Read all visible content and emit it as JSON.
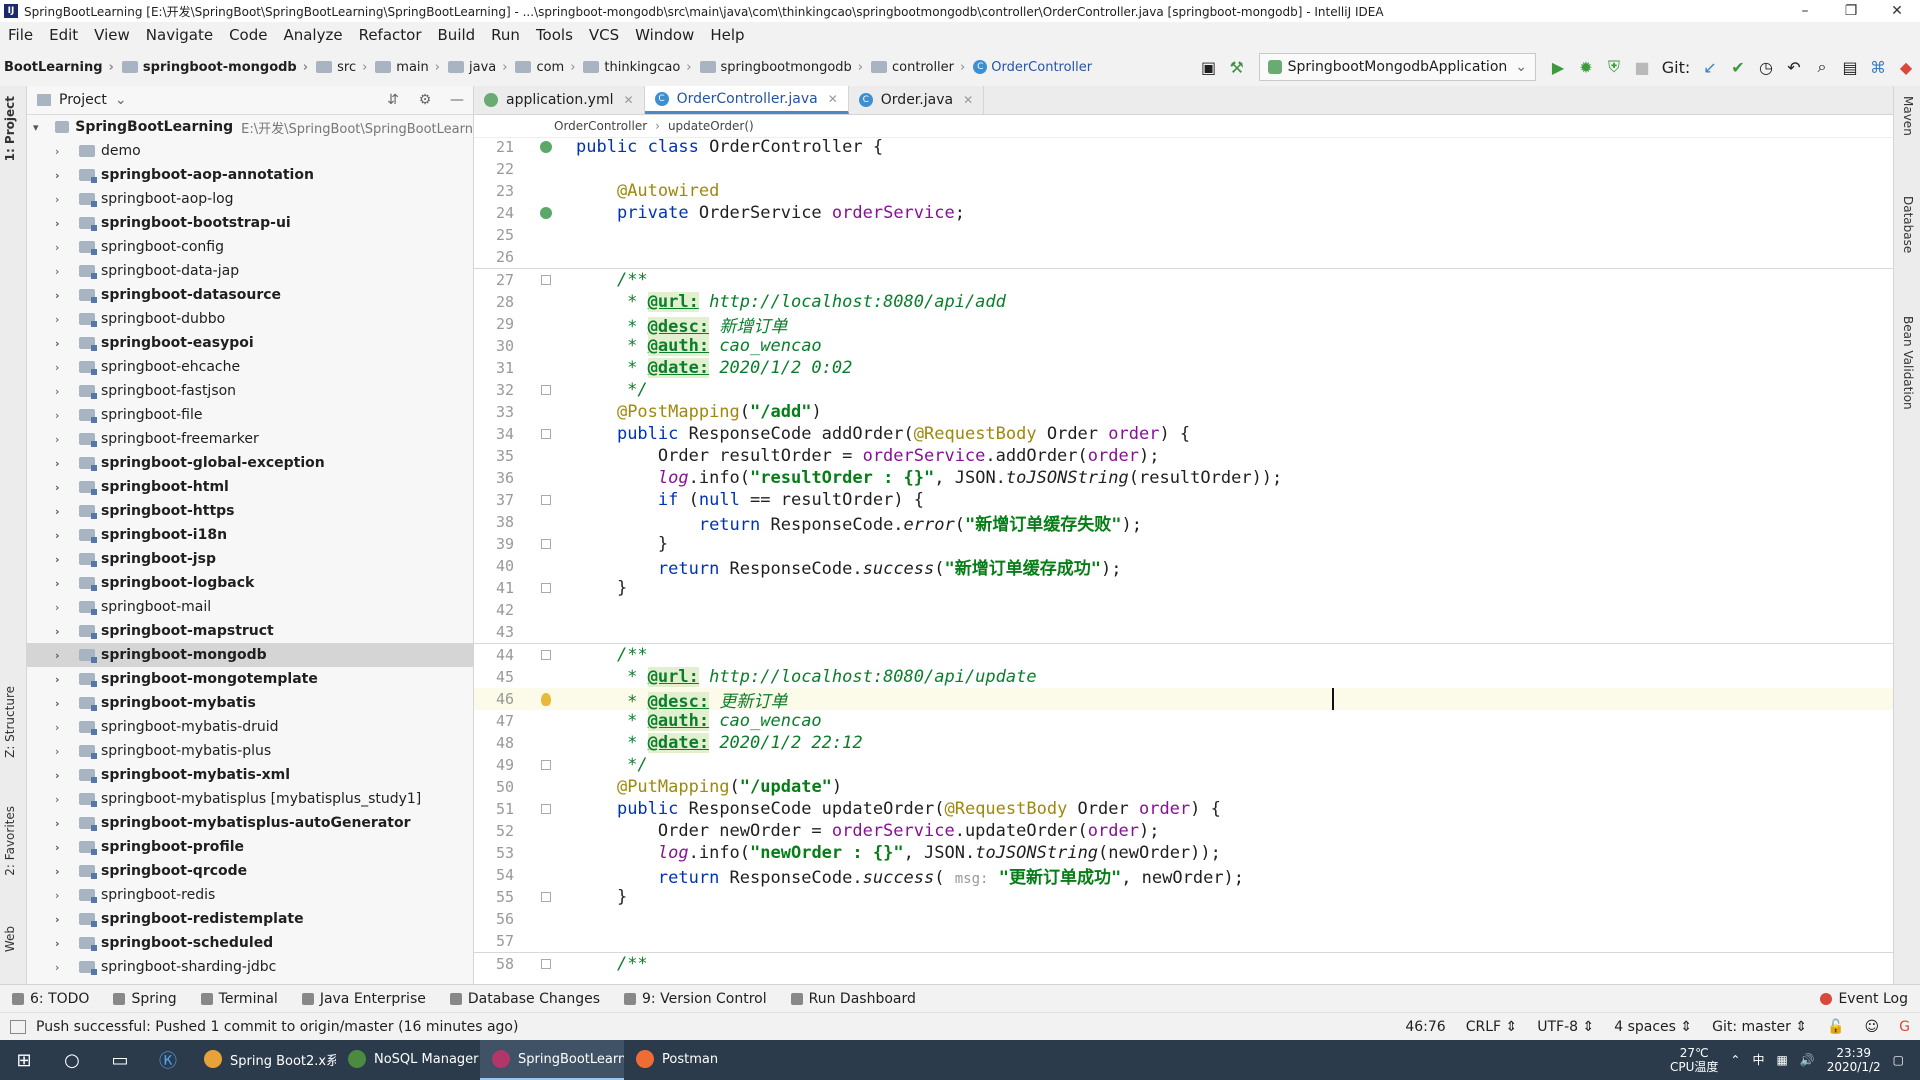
{
  "window": {
    "title": "SpringBootLearning [E:\\开发\\SpringBoot\\SpringBootLearning\\SpringBootLearning] - ...\\springboot-mongodb\\src\\main\\java\\com\\thinkingcao\\springbootmongodb\\controller\\OrderController.java [springboot-mongodb] - IntelliJ IDEA",
    "minimize": "–",
    "restore": "❐",
    "close": "✕"
  },
  "menu": [
    "File",
    "Edit",
    "View",
    "Navigate",
    "Code",
    "Analyze",
    "Refactor",
    "Build",
    "Run",
    "Tools",
    "VCS",
    "Window",
    "Help"
  ],
  "navbar": {
    "crumbs": [
      "BootLearning",
      "springboot-mongodb",
      "src",
      "main",
      "java",
      "com",
      "thinkingcao",
      "springbootmongodb",
      "controller",
      "OrderController"
    ],
    "run_config": "SpringbootMongodbApplication",
    "git_label": "Git:"
  },
  "left_tabs": [
    "1: Project",
    "Z: Structure",
    "2: Favorites",
    "Web"
  ],
  "right_tabs": [
    "Maven",
    "Database",
    "Bean Validation"
  ],
  "project": {
    "header": "Project",
    "root_name": "SpringBootLearning",
    "root_path": "E:\\开发\\SpringBoot\\SpringBootLearn",
    "items": [
      {
        "name": "demo",
        "bold": false,
        "module": false
      },
      {
        "name": "springboot-aop-annotation",
        "bold": true,
        "module": true
      },
      {
        "name": "springboot-aop-log",
        "bold": false,
        "module": true
      },
      {
        "name": "springboot-bootstrap-ui",
        "bold": true,
        "module": true
      },
      {
        "name": "springboot-config",
        "bold": false,
        "module": true
      },
      {
        "name": "springboot-data-jap",
        "bold": false,
        "module": true
      },
      {
        "name": "springboot-datasource",
        "bold": true,
        "module": true
      },
      {
        "name": "springboot-dubbo",
        "bold": false,
        "module": true
      },
      {
        "name": "springboot-easypoi",
        "bold": true,
        "module": true
      },
      {
        "name": "springboot-ehcache",
        "bold": false,
        "module": true
      },
      {
        "name": "springboot-fastjson",
        "bold": false,
        "module": true
      },
      {
        "name": "springboot-file",
        "bold": false,
        "module": true
      },
      {
        "name": "springboot-freemarker",
        "bold": false,
        "module": true
      },
      {
        "name": "springboot-global-exception",
        "bold": true,
        "module": true
      },
      {
        "name": "springboot-html",
        "bold": true,
        "module": true
      },
      {
        "name": "springboot-https",
        "bold": true,
        "module": true
      },
      {
        "name": "springboot-i18n",
        "bold": true,
        "module": true
      },
      {
        "name": "springboot-jsp",
        "bold": true,
        "module": true
      },
      {
        "name": "springboot-logback",
        "bold": true,
        "module": true
      },
      {
        "name": "springboot-mail",
        "bold": false,
        "module": true
      },
      {
        "name": "springboot-mapstruct",
        "bold": true,
        "module": true
      },
      {
        "name": "springboot-mongodb",
        "bold": true,
        "module": true,
        "selected": true
      },
      {
        "name": "springboot-mongotemplate",
        "bold": true,
        "module": true
      },
      {
        "name": "springboot-mybatis",
        "bold": true,
        "module": true
      },
      {
        "name": "springboot-mybatis-druid",
        "bold": false,
        "module": true
      },
      {
        "name": "springboot-mybatis-plus",
        "bold": false,
        "module": true
      },
      {
        "name": "springboot-mybatis-xml",
        "bold": true,
        "module": true
      },
      {
        "name": "springboot-mybatisplus [mybatisplus_study1]",
        "bold": false,
        "module": true
      },
      {
        "name": "springboot-mybatisplus-autoGenerator",
        "bold": true,
        "module": true
      },
      {
        "name": "springboot-profile",
        "bold": true,
        "module": true
      },
      {
        "name": "springboot-qrcode",
        "bold": true,
        "module": true
      },
      {
        "name": "springboot-redis",
        "bold": false,
        "module": true
      },
      {
        "name": "springboot-redistemplate",
        "bold": true,
        "module": true
      },
      {
        "name": "springboot-scheduled",
        "bold": true,
        "module": true
      },
      {
        "name": "springboot-sharding-jdbc",
        "bold": false,
        "module": true
      }
    ]
  },
  "editor": {
    "tabs": [
      {
        "label": "application.yml",
        "icon_color": "#6aab73",
        "active": false
      },
      {
        "label": "OrderController.java",
        "icon_color": "#3d8fd1",
        "active": true
      },
      {
        "label": "Order.java",
        "icon_color": "#3d8fd1",
        "active": false
      }
    ],
    "breadcrumb": [
      "OrderController",
      "updateOrder()"
    ],
    "lines": [
      {
        "n": "21",
        "gutter": "bean",
        "html": "<span class='kw'>public class</span> OrderController {"
      },
      {
        "n": "22",
        "html": ""
      },
      {
        "n": "23",
        "html": "    <span class='ann'>@Autowired</span>"
      },
      {
        "n": "24",
        "gutter": "bean",
        "html": "    <span class='kw'>private</span> OrderService <span class='fld'>orderService</span>;"
      },
      {
        "n": "25",
        "html": ""
      },
      {
        "n": "26",
        "html": "",
        "sep": true
      },
      {
        "n": "27",
        "gutter": "fold",
        "html": "    <span class='doc'>/**</span>"
      },
      {
        "n": "28",
        "html": "<span class='doc'>     * </span><span class='doc-tag'>@url:</span><span class='doc'> http://localhost:8080/api/add</span>"
      },
      {
        "n": "29",
        "html": "<span class='doc'>     * </span><span class='doc-tag'>@desc:</span><span class='doc'> 新增订单</span>"
      },
      {
        "n": "30",
        "html": "<span class='doc'>     * </span><span class='doc-tag'>@auth:</span><span class='doc'> cao_wencao</span>"
      },
      {
        "n": "31",
        "html": "<span class='doc'>     * </span><span class='doc-tag'>@date:</span><span class='doc'> 2020/1/2 0:02</span>"
      },
      {
        "n": "32",
        "gutter": "fold",
        "html": "<span class='doc'>     */</span>"
      },
      {
        "n": "33",
        "html": "    <span class='ann'>@PostMapping</span>(<span class='str'>\"/add\"</span>)"
      },
      {
        "n": "34",
        "gutter": "fold",
        "html": "    <span class='kw'>public</span> ResponseCode addOrder(<span class='ann'>@RequestBody</span> Order <span class='fld'>order</span>) {"
      },
      {
        "n": "35",
        "html": "        Order resultOrder = <span class='fld'>orderService</span>.addOrder(<span class='fld'>order</span>);"
      },
      {
        "n": "36",
        "html": "        <span class='fld ital'>log</span>.info(<span class='str'>\"resultOrder : {}\"</span>, JSON.<span class='ital'>toJSONString</span>(resultOrder));"
      },
      {
        "n": "37",
        "gutter": "fold",
        "html": "        <span class='kw'>if</span> (<span class='kw'>null</span> == resultOrder) {"
      },
      {
        "n": "38",
        "html": "            <span class='kw'>return</span> ResponseCode.<span class='ital'>error</span>(<span class='str'>\"新增订单缓存失败\"</span>);"
      },
      {
        "n": "39",
        "gutter": "fold",
        "html": "        }"
      },
      {
        "n": "40",
        "html": "        <span class='kw'>return</span> ResponseCode.<span class='ital'>success</span>(<span class='str'>\"新增订单缓存成功\"</span>);"
      },
      {
        "n": "41",
        "gutter": "fold",
        "html": "    }"
      },
      {
        "n": "42",
        "html": ""
      },
      {
        "n": "43",
        "html": "",
        "sep": true
      },
      {
        "n": "44",
        "gutter": "fold",
        "html": "    <span class='doc'>/**</span>"
      },
      {
        "n": "45",
        "html": "<span class='doc'>     * </span><span class='doc-tag'>@url:</span><span class='doc'> http://localhost:8080/api/update</span>"
      },
      {
        "n": "46",
        "gutter": "bulb",
        "hl": true,
        "caret": true,
        "html": "<span class='doc'>     * </span><span class='doc-tag'>@desc:</span><span class='doc'> 更新订单</span>"
      },
      {
        "n": "47",
        "html": "<span class='doc'>     * </span><span class='doc-tag'>@auth:</span><span class='doc'> cao_wencao</span>"
      },
      {
        "n": "48",
        "html": "<span class='doc'>     * </span><span class='doc-tag'>@date:</span><span class='doc'> 2020/1/2 22:12</span>"
      },
      {
        "n": "49",
        "gutter": "fold",
        "html": "<span class='doc'>     */</span>"
      },
      {
        "n": "50",
        "html": "    <span class='ann'>@PutMapping</span>(<span class='str'>\"/update\"</span>)"
      },
      {
        "n": "51",
        "gutter": "fold",
        "html": "    <span class='kw'>public</span> ResponseCode updateOrder(<span class='ann'>@RequestBody</span> Order <span class='fld'>order</span>) {"
      },
      {
        "n": "52",
        "html": "        Order newOrder = <span class='fld'>orderService</span>.updateOrder(<span class='fld'>order</span>);"
      },
      {
        "n": "53",
        "html": "        <span class='fld ital'>log</span>.info(<span class='str'>\"newOrder : {}\"</span>, JSON.<span class='ital'>toJSONString</span>(newOrder));"
      },
      {
        "n": "54",
        "html": "        <span class='kw'>return</span> ResponseCode.<span class='ital'>success</span>( <span class='hint'>msg:</span> <span class='str'>\"更新订单成功\"</span>, newOrder);"
      },
      {
        "n": "55",
        "gutter": "fold",
        "html": "    }"
      },
      {
        "n": "56",
        "html": ""
      },
      {
        "n": "57",
        "html": "",
        "sep": true
      },
      {
        "n": "58",
        "gutter": "fold",
        "html": "    <span class='doc'>/**</span>"
      }
    ]
  },
  "bottom_tools": [
    {
      "label": "6: TODO"
    },
    {
      "label": "Spring"
    },
    {
      "label": "Terminal"
    },
    {
      "label": "Java Enterprise"
    },
    {
      "label": "Database Changes"
    },
    {
      "label": "9: Version Control"
    },
    {
      "label": "Run Dashboard"
    }
  ],
  "event_log": "Event Log",
  "status": {
    "message": "Push successful: Pushed 1 commit to origin/master (16 minutes ago)",
    "position": "46:76",
    "line_sep": "CRLF ⇕",
    "encoding": "UTF-8 ⇕",
    "indent": "4 spaces ⇕",
    "git": "Git: master ⇕"
  },
  "taskbar": {
    "apps": [
      {
        "label": "Spring Boot2.x系...",
        "color": "#e8a23a"
      },
      {
        "label": "NoSQL Manager ...",
        "color": "#4c8a3f"
      },
      {
        "label": "SpringBootLearni...",
        "color": "#b1376a",
        "active": true
      },
      {
        "label": "Postman",
        "color": "#ef6c35"
      }
    ],
    "temp": "27℃",
    "temp_label": "CPU温度",
    "time": "23:39",
    "date": "2020/1/2"
  }
}
